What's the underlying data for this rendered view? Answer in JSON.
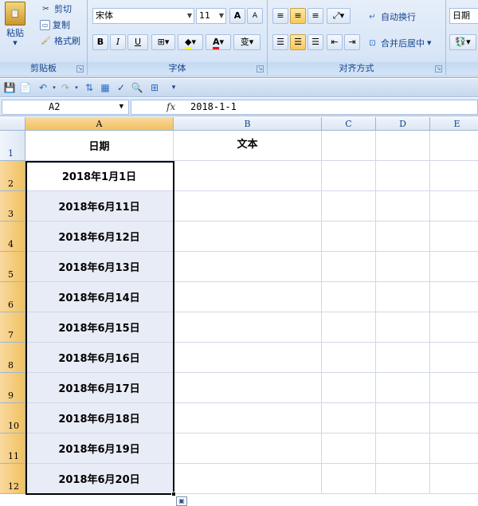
{
  "ribbon": {
    "clipboard": {
      "group_label": "剪贴板",
      "paste_label": "粘贴",
      "cut_label": "剪切",
      "copy_label": "复制",
      "format_painter_label": "格式刷"
    },
    "font": {
      "group_label": "字体",
      "font_name": "宋体",
      "font_size": "11",
      "grow_label": "A",
      "shrink_label": "A",
      "bold_label": "B",
      "italic_label": "I",
      "underline_label": "U",
      "font_color_label": "A",
      "phonetic_label": "变"
    },
    "alignment": {
      "group_label": "对齐方式",
      "wrap_text_label": "自动换行",
      "merge_center_label": "合并后居中"
    },
    "number": {
      "format_value": "日期"
    }
  },
  "formula_bar": {
    "name_box": "A2",
    "fx_label": "fx",
    "formula": "2018-1-1"
  },
  "grid": {
    "columns": [
      "A",
      "B",
      "C",
      "D",
      "E"
    ],
    "selected_column": "A",
    "header_row": {
      "row_number": "1",
      "a": "日期",
      "b": "文本"
    },
    "rows": [
      {
        "row_number": "2",
        "a": "2018年1月1日"
      },
      {
        "row_number": "3",
        "a": "2018年6月11日"
      },
      {
        "row_number": "4",
        "a": "2018年6月12日"
      },
      {
        "row_number": "5",
        "a": "2018年6月13日"
      },
      {
        "row_number": "6",
        "a": "2018年6月14日"
      },
      {
        "row_number": "7",
        "a": "2018年6月15日"
      },
      {
        "row_number": "8",
        "a": "2018年6月16日"
      },
      {
        "row_number": "9",
        "a": "2018年6月17日"
      },
      {
        "row_number": "10",
        "a": "2018年6月18日"
      },
      {
        "row_number": "11",
        "a": "2018年6月19日"
      },
      {
        "row_number": "12",
        "a": "2018年6月20日"
      }
    ]
  },
  "colors": {
    "ribbon_bg": "#dbe6f6",
    "selection_header": "#f5cd7a",
    "selection_fill": "#e8ecf6",
    "gridline": "#d0d7e5"
  }
}
